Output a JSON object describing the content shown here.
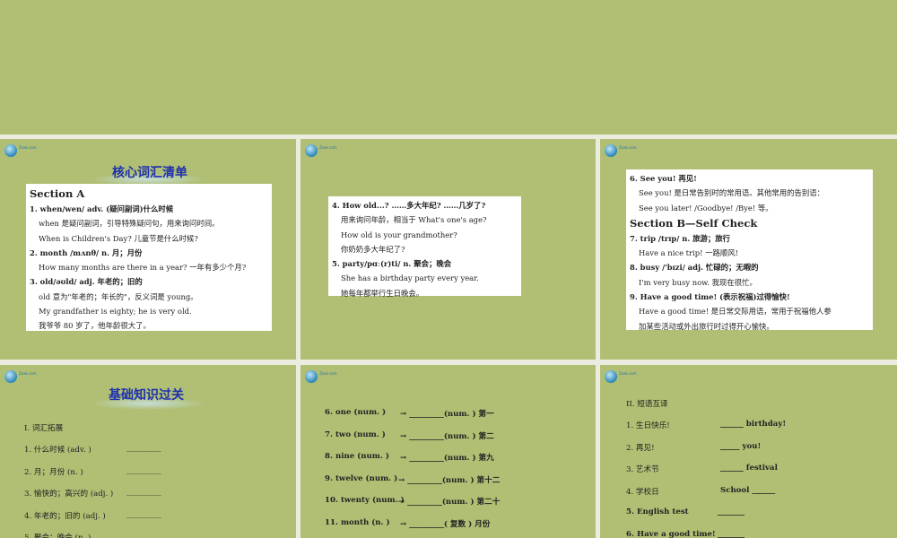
{
  "slide1": {
    "title": "核心词汇清单",
    "section": "Section A",
    "lines": [
      {
        "head": "1. when/wen/ adv. (疑问副词)什么时候"
      },
      {
        "text": "when 是疑问副词，引导特殊疑问句，用来询问时间。"
      },
      {
        "text": "When is Children's Day? 儿童节是什么时候?"
      },
      {
        "head": "2. month /mʌnθ/ n. 月；月份"
      },
      {
        "text": "How many months are there in a year? 一年有多少个月?"
      },
      {
        "head": "3. old/əʊld/ adj. 年老的；旧的"
      },
      {
        "text": "old 意为\"年老的；年长的\"，反义词是 young。"
      },
      {
        "text": "My grandfather is eighty; he is very old."
      },
      {
        "text": "我爷爷 80 岁了，他年龄很大了。"
      }
    ]
  },
  "slide2": {
    "lines": [
      {
        "head": "4. How old...? ……多大年纪? ……几岁了?"
      },
      {
        "text": "用来询问年龄，相当于 What's one's age?"
      },
      {
        "text": "How old is your grandmother?"
      },
      {
        "text": "你奶奶多大年纪了?"
      },
      {
        "head": "5. party/pɑː(r)ti/ n. 聚会；晚会"
      },
      {
        "text": "She has a birthday party every year."
      },
      {
        "text": "她每年都举行生日晚会。"
      }
    ]
  },
  "slide3": {
    "section": "Section B—Self Check",
    "lines_a": [
      {
        "head": "6. See you! 再见!"
      },
      {
        "text": "See you! 是日常告别时的常用语。其他常用的告别语："
      },
      {
        "text": "See you later! /Goodbye! /Bye! 等。"
      }
    ],
    "lines_b": [
      {
        "head": "7. trip /trɪp/ n. 旅游；旅行"
      },
      {
        "text": "Have a nice trip! 一路顺风!"
      },
      {
        "head": "8. busy /'bɪzi/ adj. 忙碌的；无暇的"
      },
      {
        "text": "I'm very busy now. 我现在很忙。"
      },
      {
        "head": "9. Have a good time! (表示祝福)过得愉快!"
      },
      {
        "text": "Have a good time! 是日常交际用语，常用于祝福他人参"
      },
      {
        "text": "加某些活动或外出旅行时过得开心愉快。"
      }
    ]
  },
  "slide4": {
    "title": "基础知识过关",
    "heading": "I. 词汇拓展",
    "items": [
      {
        "label": "1. 什么时候 (adv. )",
        "blank": "_________"
      },
      {
        "label": "2. 月；月份 (n. )",
        "blank": "_________"
      },
      {
        "label": "3. 愉快的；高兴的 (adj. )",
        "blank": "_________"
      },
      {
        "label": "4. 年老的；旧的 (adj. )",
        "blank": "_________"
      },
      {
        "label": "5. 聚会；晚会 (n. )",
        "blank": ""
      }
    ]
  },
  "slide5": {
    "items": [
      {
        "label": "6. one (num. )",
        "rest": "→ _________(num. ) 第一"
      },
      {
        "label": "7. two (num. )",
        "rest": "→ _________(num. ) 第二"
      },
      {
        "label": "8. nine (num. )",
        "rest": "→ _________(num. ) 第九"
      },
      {
        "label": "9. twelve (num. )",
        "rest": "→ _________(num. ) 第十二"
      },
      {
        "label": "10. twenty (num. )",
        "rest": "→ _________(num. ) 第二十"
      },
      {
        "label": "11. month (n. )",
        "rest": "→ _________( 复数 ) 月份"
      }
    ]
  },
  "slide6": {
    "heading": "II. 短语互译",
    "items": [
      {
        "label": "1. 生日快乐!",
        "answer": "______ birthday!"
      },
      {
        "label": "2. 再见!",
        "answer": "_____ you!"
      },
      {
        "label": "3. 艺术节",
        "answer": "______ festival"
      },
      {
        "label": "4. 学校日",
        "answer": "School ______"
      },
      {
        "label": "5. English test",
        "answer": "_______"
      },
      {
        "label": "6. Have a good time!",
        "answer": "_______"
      }
    ]
  },
  "logo_text": "Zxxk.com",
  "colors": {
    "slide_bg": "#b0bf74",
    "title": "#1d2fb0",
    "gap": "#ecebdf"
  }
}
